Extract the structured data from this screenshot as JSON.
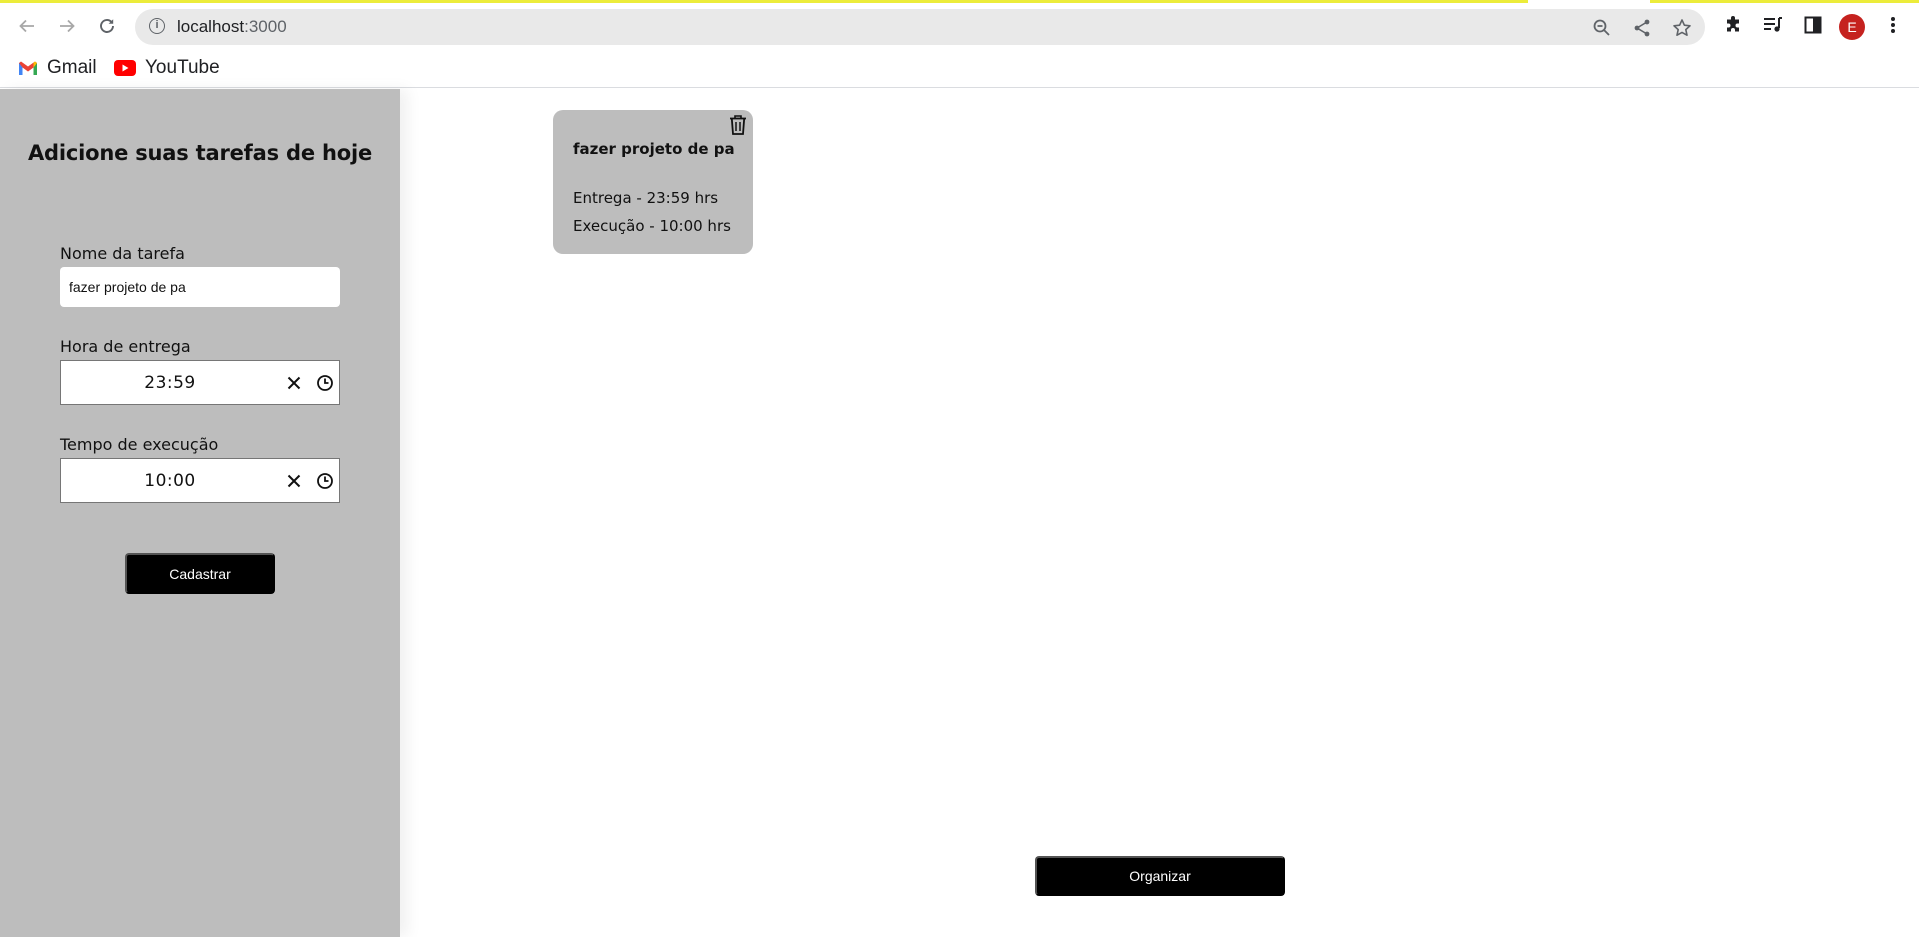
{
  "browser": {
    "url_host": "localhost",
    "url_port": ":3000",
    "avatar_letter": "E",
    "bookmarks": [
      {
        "label": "Gmail",
        "icon": "gmail-icon"
      },
      {
        "label": "YouTube",
        "icon": "youtube-icon"
      }
    ]
  },
  "sidebar": {
    "heading": "Adicione suas tarefas de hoje",
    "task_name_label": "Nome da tarefa",
    "task_name_value": "fazer projeto de pa",
    "delivery_label": "Hora de entrega",
    "delivery_value": "23:59",
    "execution_label": "Tempo de execução",
    "execution_value": "10:00",
    "submit_label": "Cadastrar"
  },
  "tasks": [
    {
      "title": "fazer projeto de pa",
      "delivery_text": "Entrega - 23:59 hrs",
      "execution_text": "Execução - 10:00 hrs"
    }
  ],
  "main": {
    "organize_label": "Organizar"
  },
  "colors": {
    "sidebar_bg": "#bdbdbd",
    "card_bg": "#bdbdbd",
    "button_bg": "#000000",
    "loading_bar": "#ecec3a"
  }
}
